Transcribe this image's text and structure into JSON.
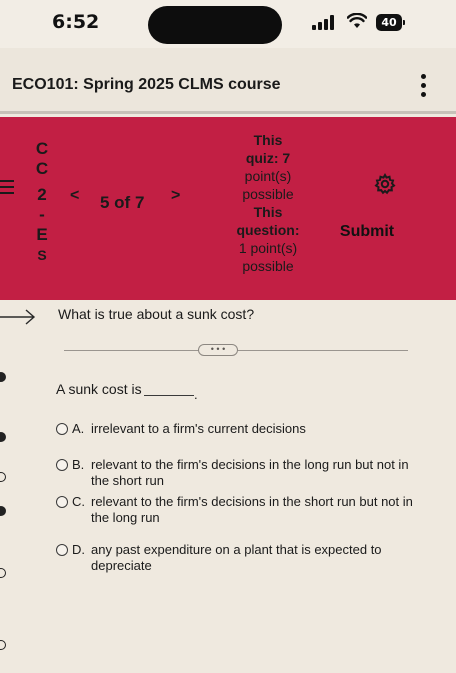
{
  "status_bar": {
    "time": "6:52",
    "battery": "40"
  },
  "course": {
    "title": "ECO101: Spring 2025 CLMS course"
  },
  "quiz_header": {
    "side_label": [
      "C",
      "C",
      "2",
      "-",
      "E",
      "S"
    ],
    "prev_symbol": "<",
    "question_counter": "5 of 7",
    "next_symbol": ">",
    "quiz_points_label_1": "This",
    "quiz_points_label_2": "quiz: 7",
    "quiz_points_label_3": "point(s)",
    "quiz_points_label_4": "possible",
    "question_points_label_1": "This",
    "question_points_label_2": "question:",
    "question_points_label_3": "1 point(s)",
    "question_points_label_4": "possible",
    "submit_label": "Submit",
    "accent": "#c21f44"
  },
  "question": {
    "text": "What is true about a sunk cost?",
    "prompt": "A sunk cost is",
    "blank_end": ".",
    "options": [
      {
        "letter": "A.",
        "text": "irrelevant to a firm's current decisions"
      },
      {
        "letter": "B.",
        "text": "relevant to the firm's decisions in the long run but not in the short run"
      },
      {
        "letter": "C.",
        "text": "relevant to the firm's decisions in the short run but not in the long run"
      },
      {
        "letter": "D.",
        "text": "any past expenditure on a plant that is expected to depreciate"
      }
    ]
  }
}
